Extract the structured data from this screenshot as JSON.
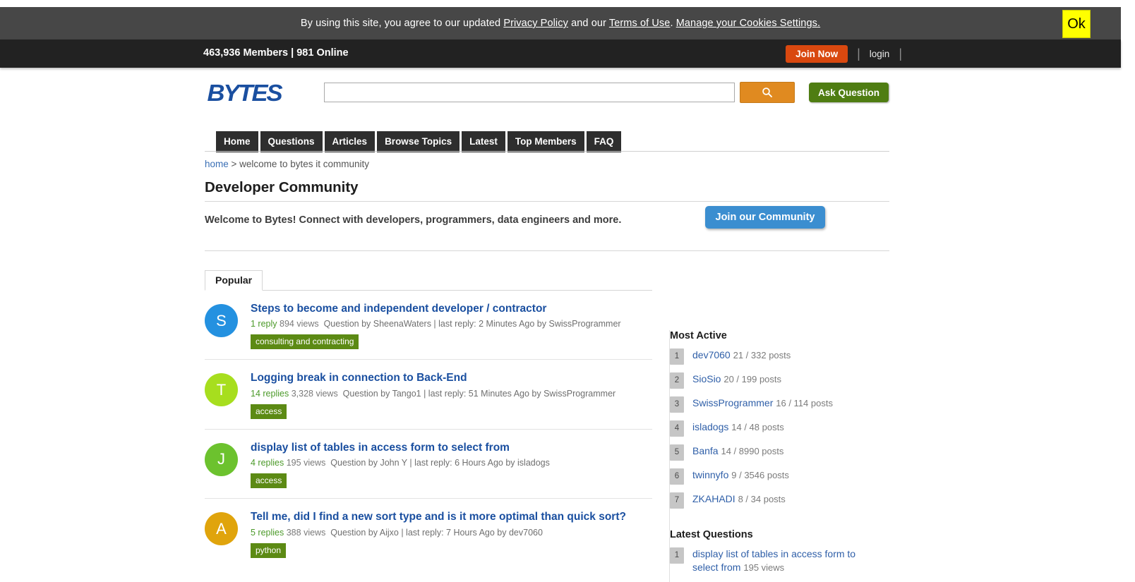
{
  "cookie_banner": {
    "text_parts": {
      "lead": "By using this site, you agree to our updated ",
      "privacy_policy": "Privacy Policy",
      "middle": " and our ",
      "terms": "Terms of Use",
      "period": ". ",
      "manage": "Manage your Cookies Settings."
    },
    "ok_label": "Ok"
  },
  "members_bar": {
    "stats": "463,936 Members | 981 Online",
    "join_now_label": "Join Now",
    "separator": "|",
    "login_label": "login"
  },
  "header": {
    "logo_text": "BYTES",
    "search_value": "",
    "search_placeholder": "",
    "search_icon": "search-icon",
    "ask_question_label": "Ask Question"
  },
  "nav": {
    "items": [
      {
        "label": "Home"
      },
      {
        "label": "Questions"
      },
      {
        "label": "Articles"
      },
      {
        "label": "Browse Topics"
      },
      {
        "label": "Latest"
      },
      {
        "label": "Top Members"
      },
      {
        "label": "FAQ"
      }
    ]
  },
  "breadcrumb": {
    "home": "home",
    "separator": " > ",
    "current": "welcome to bytes it community"
  },
  "page": {
    "title": "Developer Community",
    "welcome": "Welcome to Bytes! Connect with developers, programmers, data engineers and more.",
    "join_community_label": "Join our Community"
  },
  "main": {
    "tabs": [
      {
        "label": "Popular",
        "active": true
      }
    ],
    "posts": [
      {
        "avatar_letter": "S",
        "avatar_color": "#2491e0",
        "title": "Steps to become and independent developer / contractor",
        "replies": "1 reply",
        "views": "894 views",
        "meta_rest": "Question by SheenaWaters | last reply: 2 Minutes Ago by SwissProgrammer",
        "tag": "consulting and contracting"
      },
      {
        "avatar_letter": "T",
        "avatar_color": "#a7de1e",
        "title": "Logging break in connection to Back-End",
        "replies": "14 replies",
        "views": "3,328 views",
        "meta_rest": "Question by Tango1 | last reply: 51 Minutes Ago by SwissProgrammer",
        "tag": "access"
      },
      {
        "avatar_letter": "J",
        "avatar_color": "#6cc22e",
        "title": "display list of tables in access form to select from",
        "replies": "4 replies",
        "views": "195 views",
        "meta_rest": "Question by John Y | last reply: 6 Hours Ago by isladogs",
        "tag": "access"
      },
      {
        "avatar_letter": "A",
        "avatar_color": "#e0a40c",
        "title": "Tell me, did I find a new sort type and is it more optimal than quick sort?",
        "replies": "5 replies",
        "views": "388 views",
        "meta_rest": "Question by Aijxo | last reply: 7 Hours Ago by dev7060",
        "tag": "python"
      }
    ]
  },
  "sidebar": {
    "most_active": {
      "heading": "Most Active",
      "items": [
        {
          "rank": "1",
          "name": "dev7060",
          "stats": "21 / 332 posts"
        },
        {
          "rank": "2",
          "name": "SioSio",
          "stats": "20 / 199 posts"
        },
        {
          "rank": "3",
          "name": "SwissProgrammer",
          "stats": "16 / 114 posts"
        },
        {
          "rank": "4",
          "name": "isladogs",
          "stats": "14 / 48 posts"
        },
        {
          "rank": "5",
          "name": "Banfa",
          "stats": "14 / 8990 posts"
        },
        {
          "rank": "6",
          "name": "twinnyfo",
          "stats": "9 / 3546 posts"
        },
        {
          "rank": "7",
          "name": "ZKAHADI",
          "stats": "8 / 34 posts"
        }
      ]
    },
    "latest_questions": {
      "heading": "Latest Questions",
      "items": [
        {
          "rank": "1",
          "title": "display list of tables in access form to select from",
          "stats": "195 views"
        }
      ]
    }
  }
}
